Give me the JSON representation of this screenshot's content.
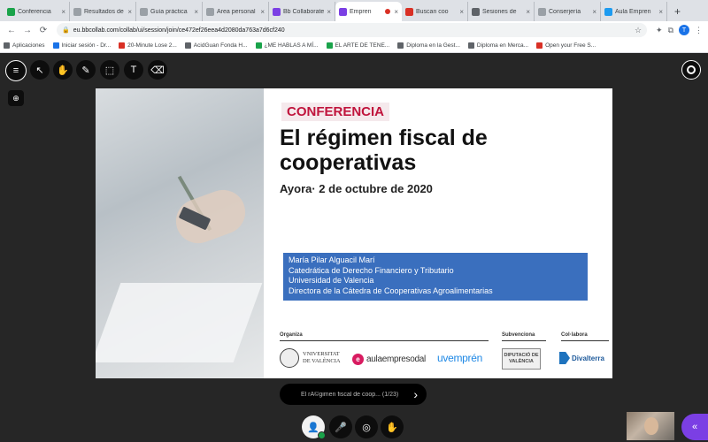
{
  "browser": {
    "tabs": [
      {
        "label": "Conferencia",
        "favicon_color": "#1aa34a",
        "active": false
      },
      {
        "label": "Resultados de",
        "favicon_color": "#9aa0a6",
        "active": false
      },
      {
        "label": "Guía práctica",
        "favicon_color": "#9aa0a6",
        "active": false
      },
      {
        "label": "Área personal",
        "favicon_color": "#9aa0a6",
        "active": false
      },
      {
        "label": "Bb Collaborate",
        "favicon_color": "#7b3fe4",
        "active": false
      },
      {
        "label": "Empren",
        "favicon_color": "#7b3fe4",
        "active": true,
        "recording": true
      },
      {
        "label": "Buscan coo",
        "favicon_color": "#d93025",
        "active": false
      },
      {
        "label": "Sesiones de",
        "favicon_color": "#5f6368",
        "active": false
      },
      {
        "label": "Conserjería",
        "favicon_color": "#9aa0a6",
        "active": false
      },
      {
        "label": "Aula Empren",
        "favicon_color": "#1d9bf0",
        "active": false
      }
    ],
    "new_tab": "+",
    "url": "eu.bbcollab.com/collab/ui/session/join/ce472ef26eea4d2080da763a7d6cf240",
    "profile_initial": "T",
    "bookmarks": [
      {
        "label": "Aplicaciones",
        "color": "#5f6368"
      },
      {
        "label": "Iniciar sesión - Dr...",
        "color": "#1a73e8"
      },
      {
        "label": "20-Minute Lose 2...",
        "color": "#d93025"
      },
      {
        "label": "AcidGuan Fonda H...",
        "color": "#5f6368"
      },
      {
        "label": "¿ME HABLAS A MÍ...",
        "color": "#1aa34a"
      },
      {
        "label": "EL ARTE DE TENE...",
        "color": "#1aa34a"
      },
      {
        "label": "Diploma en la Gest...",
        "color": "#5f6368"
      },
      {
        "label": "Diploma en Merca...",
        "color": "#5f6368"
      },
      {
        "label": "Open your Free S...",
        "color": "#d93025"
      }
    ]
  },
  "collab": {
    "toolbar": {
      "menu_icon": "≡",
      "pointer_icon": "↖",
      "pan_icon": "✋",
      "pen_icon": "✎",
      "shape_icon": "⬚",
      "text_icon": "T",
      "eraser_icon": "⌫",
      "zoom_icon": "⊕"
    },
    "slide": {
      "tag": "CONFERENCIA",
      "title": "El régimen fiscal de cooperativas",
      "subtitle": "Ayora· 2 de octubre de 2020",
      "speaker_lines": [
        "María Pilar Alguacil Marí",
        "Catedrática de Derecho Financiero y Tributario",
        "Universidad de Valencia",
        "Directora de la Cátedra de Cooperativas Agroalimentarias"
      ],
      "organiza_label": "Organiza",
      "subvenciona_label": "Subvenciona",
      "colabora_label": "Col·labora",
      "uv_logo_line1": "VNIVERSITAT",
      "uv_logo_line2": "DE VALÈNCIA",
      "aula_logo": "aulaempresodal",
      "uvemp_logo": "uvemprén",
      "dip_logo_line1": "DIPUTACIÓ DE",
      "dip_logo_line2": "VALÈNCIA",
      "divalterra_logo": "Divalterra"
    },
    "pager": {
      "file_name": "El rÃ©gimen fiscal de coop...  (1/23)",
      "next_icon": "›"
    },
    "bottom": {
      "mic_icon": "🎤",
      "camera_icon": "◎",
      "hand_icon": "✋",
      "panel_icon": "«"
    }
  }
}
